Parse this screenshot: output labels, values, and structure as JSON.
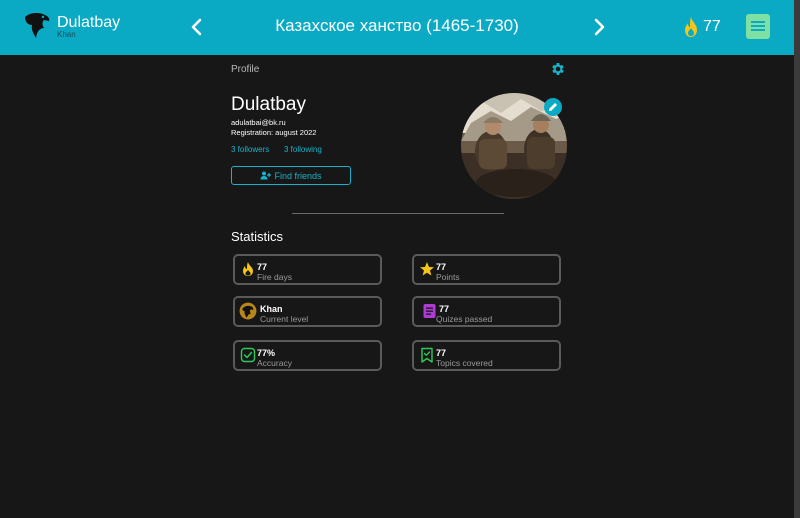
{
  "header": {
    "brand_name": "Dulatbay",
    "brand_rank": "Khan",
    "course_title": "Казахское ханство (1465-1730)",
    "streak_count": "77"
  },
  "icons": {
    "brand": "eagle-icon",
    "prev": "chevron-left-icon",
    "next": "chevron-right-icon",
    "streak": "fire-icon",
    "menu": "document-icon",
    "settings": "gear-icon",
    "edit": "pencil-icon",
    "add_friend": "add-user-icon"
  },
  "profile": {
    "section_label": "Profile",
    "username": "Dulatbay",
    "email": "adulatbai@bk.ru",
    "registration": "Registration: august 2022",
    "followers": "3 followers",
    "following": "3 following",
    "find_friends": "Find friends"
  },
  "statistics": {
    "title": "Statistics",
    "items": [
      {
        "value": "77",
        "label": "Fire days",
        "icon": "fire-icon"
      },
      {
        "value": "77",
        "label": "Points",
        "icon": "star-icon"
      },
      {
        "value": "Khan",
        "label": "Current level",
        "icon": "eagle-badge-icon"
      },
      {
        "value": "77",
        "label": "Quizes passed",
        "icon": "quiz-icon"
      },
      {
        "value": "77%",
        "label": "Accuracy",
        "icon": "check-icon"
      },
      {
        "value": "77",
        "label": "Topics covered",
        "icon": "bookmark-check-icon"
      }
    ]
  },
  "colors": {
    "header_bg": "#0aaac5",
    "page_bg": "#171717",
    "accent": "#18b3c9",
    "menu_button": "#7ee0a3",
    "fire": "#f5c518",
    "quiz": "#b03ad6",
    "accuracy": "#2fc95a"
  }
}
